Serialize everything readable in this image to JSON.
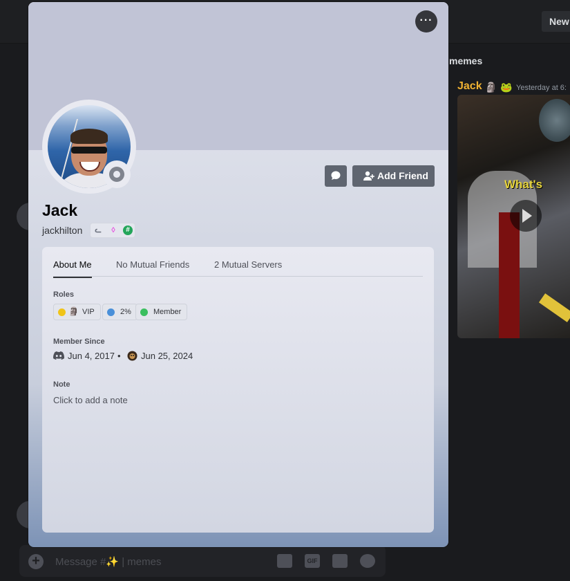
{
  "background": {
    "new_button": "New",
    "channel_name": "memes",
    "message_author": "Jack",
    "author_badges": [
      "🗿",
      "🐸"
    ],
    "message_time": "Yesterday at 6:",
    "video_caption": "What's",
    "composer_placeholder": "Message #✨ | memes",
    "composer_plus": "+",
    "composer_gif": "GIF"
  },
  "profile": {
    "more_button": "···",
    "display_name": "Jack",
    "username": "jackhilton",
    "badges": [
      "nitro-speed-badge",
      "nitro-gem-badge",
      "hashtag-badge"
    ],
    "badge_glyphs": [
      "ᓚ",
      "◊",
      "#"
    ],
    "add_friend_label": "Add Friend",
    "status": "offline",
    "tabs": [
      "About Me",
      "No Mutual Friends",
      "2 Mutual Servers"
    ],
    "active_tab": "About Me",
    "roles_heading": "Roles",
    "roles": [
      {
        "label": "VIP",
        "color": "#f0c419",
        "emoji": "🗿"
      },
      {
        "label": "2%",
        "color": "#4a90d9"
      },
      {
        "label": "Member",
        "color": "#3bbf5f"
      }
    ],
    "member_since_heading": "Member Since",
    "discord_since": "Jun 4, 2017",
    "separator": "•",
    "server_since": "Jun 25, 2024",
    "note_heading": "Note",
    "note_placeholder": "Click to add a note"
  },
  "colors": {
    "banner": "#c1c4d6",
    "button": "#5f6570",
    "author": "#f0b232"
  }
}
